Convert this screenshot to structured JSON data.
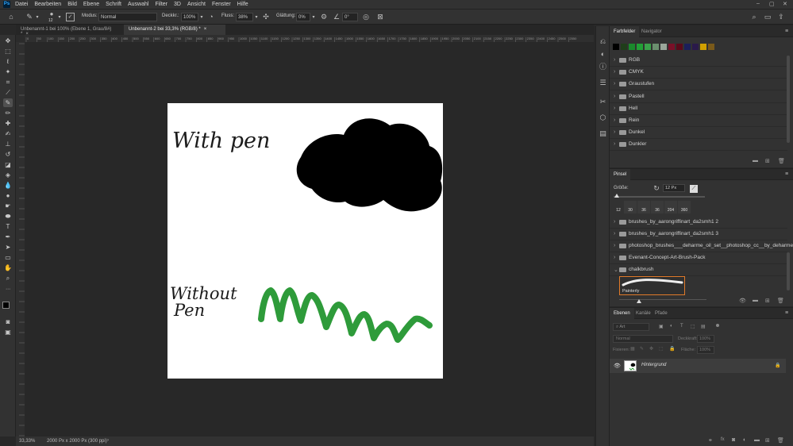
{
  "menu": {
    "app_logo": "Ps",
    "items": [
      "Datei",
      "Bearbeiten",
      "Bild",
      "Ebene",
      "Schrift",
      "Auswahl",
      "Filter",
      "3D",
      "Ansicht",
      "Fenster",
      "Hilfe"
    ]
  },
  "options": {
    "brush_size": "12",
    "mode_label": "Modus:",
    "mode_value": "Normal",
    "opacity_label": "Deckkr.:",
    "opacity_value": "100%",
    "flow_label": "Fluss:",
    "flow_value": "38%",
    "smoothing_label": "Glättung:",
    "smoothing_value": "0%",
    "angle_value": "0°"
  },
  "doc_tabs": [
    {
      "label": "Unbenannt-1 bei 100% (Ebene 1, Grau/8#) *"
    },
    {
      "label": "Unbenannt-2 bei 33,3% (RGB/8) *"
    }
  ],
  "ruler_ticks": [
    "0",
    "50",
    "100",
    "150",
    "200",
    "250",
    "300",
    "350",
    "400",
    "450",
    "500",
    "550",
    "600",
    "650",
    "700",
    "750",
    "800",
    "850",
    "900",
    "950",
    "1000",
    "1050",
    "1100",
    "1150",
    "1200",
    "1250",
    "1300",
    "1350",
    "1400",
    "1450",
    "1500",
    "1550",
    "1600",
    "1650",
    "1700",
    "1750",
    "1800",
    "1850",
    "1900",
    "1950",
    "2000",
    "2050",
    "2100",
    "2150",
    "2200",
    "2250",
    "2300",
    "2350",
    "2400",
    "2450",
    "2500",
    "2550"
  ],
  "canvas": {
    "text_with_pen": "With pen",
    "text_without_1": "Without",
    "text_without_2": "Pen"
  },
  "status": {
    "zoom": "33,33%",
    "doc_info": "2000 Px x 2000 Px (300 ppi)"
  },
  "swatches_panel": {
    "tabs": [
      "Farbfelder",
      "Navigator"
    ],
    "colors": [
      "#000000",
      "#1f3d1a",
      "#1a8a2c",
      "#22a036",
      "#3aa24a",
      "#6b8f6e",
      "#9aa69a",
      "#7a1028",
      "#5a0a1a",
      "#1b1f5a",
      "#2a1a4a",
      "#d0a000",
      "#7a5a1a"
    ],
    "groups": [
      "RGB",
      "CMYK",
      "Graustufen",
      "Pastell",
      "Hell",
      "Rein",
      "Dunkel",
      "Dunkler"
    ]
  },
  "brush_panel": {
    "title": "Pinsel",
    "size_label": "Größe:",
    "size_value": "12 Px",
    "tip_sizes": [
      "12",
      "30",
      "36",
      "36",
      "204",
      "360"
    ],
    "folders": [
      "brushes_by_aarongriffinart_da2smh1 2",
      "brushes_by_aarongriffinart_da2smh1 3",
      "photoshop_brushes___deharme_oil_set__photoshop_cc__by_deharme_dbpg3v4",
      "Evenant-Concept-Art-Brush-Pack",
      "chalkbrush"
    ],
    "selected_brush": "Painterly"
  },
  "layers_panel": {
    "tabs": [
      "Ebenen",
      "Kanäle",
      "Pfade"
    ],
    "filter_label": "Art",
    "blend_mode": "Normal",
    "opacity_label": "Deckkraft:",
    "opacity_value": "100%",
    "lock_label": "Fixieren:",
    "fill_label": "Fläche:",
    "fill_value": "100%",
    "layer_name": "Hintergrund"
  }
}
